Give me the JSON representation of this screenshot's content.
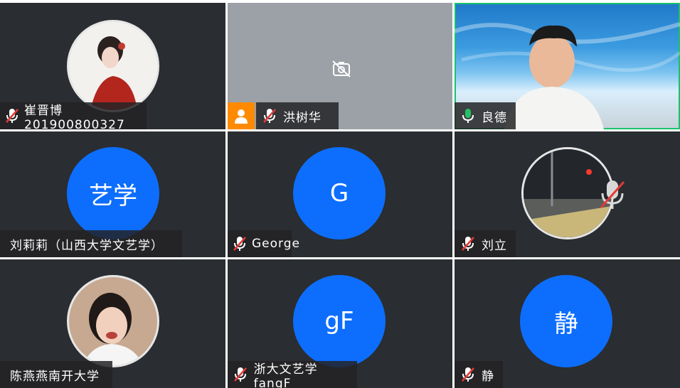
{
  "participants": [
    {
      "name": "崔晋博201900800327",
      "muted": true,
      "view": "photo-avatar"
    },
    {
      "name": "洪树华",
      "muted": true,
      "view": "camera-off"
    },
    {
      "name": "良德",
      "muted": false,
      "view": "video"
    },
    {
      "name": "刘莉莉（山西大学文艺学）",
      "muted": false,
      "view": "initials",
      "initials": "艺学"
    },
    {
      "name": "George",
      "muted": true,
      "view": "initials",
      "initials": "G"
    },
    {
      "name": "刘立",
      "muted": true,
      "view": "photo-avatar"
    },
    {
      "name": "陈燕燕南开大学",
      "muted": false,
      "view": "photo-avatar"
    },
    {
      "name": "浙大文艺学fangF",
      "muted": true,
      "view": "initials",
      "initials": "gF"
    },
    {
      "name": "静",
      "muted": true,
      "view": "initials",
      "initials": "静"
    }
  ],
  "colors": {
    "tile_bg": "#2a2d31",
    "avatar_blue": "#0d6efd",
    "active_speaker_border": "#19c26c",
    "muted_red": "#e53935",
    "mic_green": "#26c065",
    "default_avatar_orange": "#ff8a00"
  },
  "icons": [
    "mic-muted-icon",
    "mic-icon",
    "camera-off-icon",
    "user-icon"
  ]
}
